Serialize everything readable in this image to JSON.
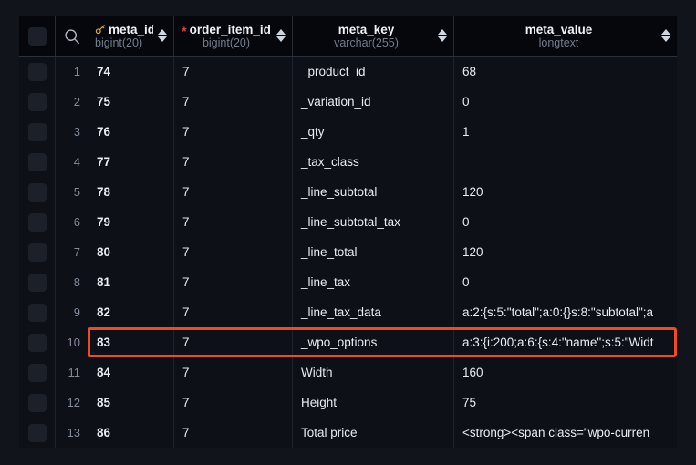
{
  "table": {
    "header": {
      "select_all_label": "",
      "search_icon": "search-icon",
      "columns": [
        {
          "name": "meta_id",
          "type": "bigint(20)",
          "key_icon": "key-icon",
          "required": false,
          "align": "left",
          "sortable": true
        },
        {
          "name": "order_item_id",
          "type": "bigint(20)",
          "key_icon": "",
          "required": true,
          "required_marker": "*",
          "align": "center",
          "sortable": true
        },
        {
          "name": "meta_key",
          "type": "varchar(255)",
          "key_icon": "",
          "required": false,
          "align": "center",
          "sortable": true
        },
        {
          "name": "meta_value",
          "type": "longtext",
          "key_icon": "",
          "required": false,
          "align": "center",
          "sortable": true
        }
      ]
    },
    "rows": [
      {
        "n": "1",
        "meta_id": "74",
        "order_item_id": "7",
        "meta_key": "_product_id",
        "meta_value": "68"
      },
      {
        "n": "2",
        "meta_id": "75",
        "order_item_id": "7",
        "meta_key": "_variation_id",
        "meta_value": "0"
      },
      {
        "n": "3",
        "meta_id": "76",
        "order_item_id": "7",
        "meta_key": "_qty",
        "meta_value": "1"
      },
      {
        "n": "4",
        "meta_id": "77",
        "order_item_id": "7",
        "meta_key": "_tax_class",
        "meta_value": ""
      },
      {
        "n": "5",
        "meta_id": "78",
        "order_item_id": "7",
        "meta_key": "_line_subtotal",
        "meta_value": "120"
      },
      {
        "n": "6",
        "meta_id": "79",
        "order_item_id": "7",
        "meta_key": "_line_subtotal_tax",
        "meta_value": "0"
      },
      {
        "n": "7",
        "meta_id": "80",
        "order_item_id": "7",
        "meta_key": "_line_total",
        "meta_value": "120"
      },
      {
        "n": "8",
        "meta_id": "81",
        "order_item_id": "7",
        "meta_key": "_line_tax",
        "meta_value": "0"
      },
      {
        "n": "9",
        "meta_id": "82",
        "order_item_id": "7",
        "meta_key": "_line_tax_data",
        "meta_value": "a:2:{s:5:\"total\";a:0:{}s:8:\"subtotal\";a"
      },
      {
        "n": "10",
        "meta_id": "83",
        "order_item_id": "7",
        "meta_key": "_wpo_options",
        "meta_value": "a:3:{i:200;a:6:{s:4:\"name\";s:5:\"Widt",
        "highlighted": true
      },
      {
        "n": "11",
        "meta_id": "84",
        "order_item_id": "7",
        "meta_key": "Width",
        "meta_value": "160"
      },
      {
        "n": "12",
        "meta_id": "85",
        "order_item_id": "7",
        "meta_key": "Height",
        "meta_value": "75"
      },
      {
        "n": "13",
        "meta_id": "86",
        "order_item_id": "7",
        "meta_key": "Total price",
        "meta_value": "  <strong><span class=\"wpo-curren"
      }
    ]
  },
  "colors": {
    "page_background": "#11141b",
    "grid_background": "#0d1017",
    "header_background": "#05070c",
    "highlight_border": "#f04a24",
    "key_icon": "#e6a817",
    "required_marker": "#e0433a",
    "text_primary": "#e8ecf2",
    "text_muted": "#737d8c"
  }
}
